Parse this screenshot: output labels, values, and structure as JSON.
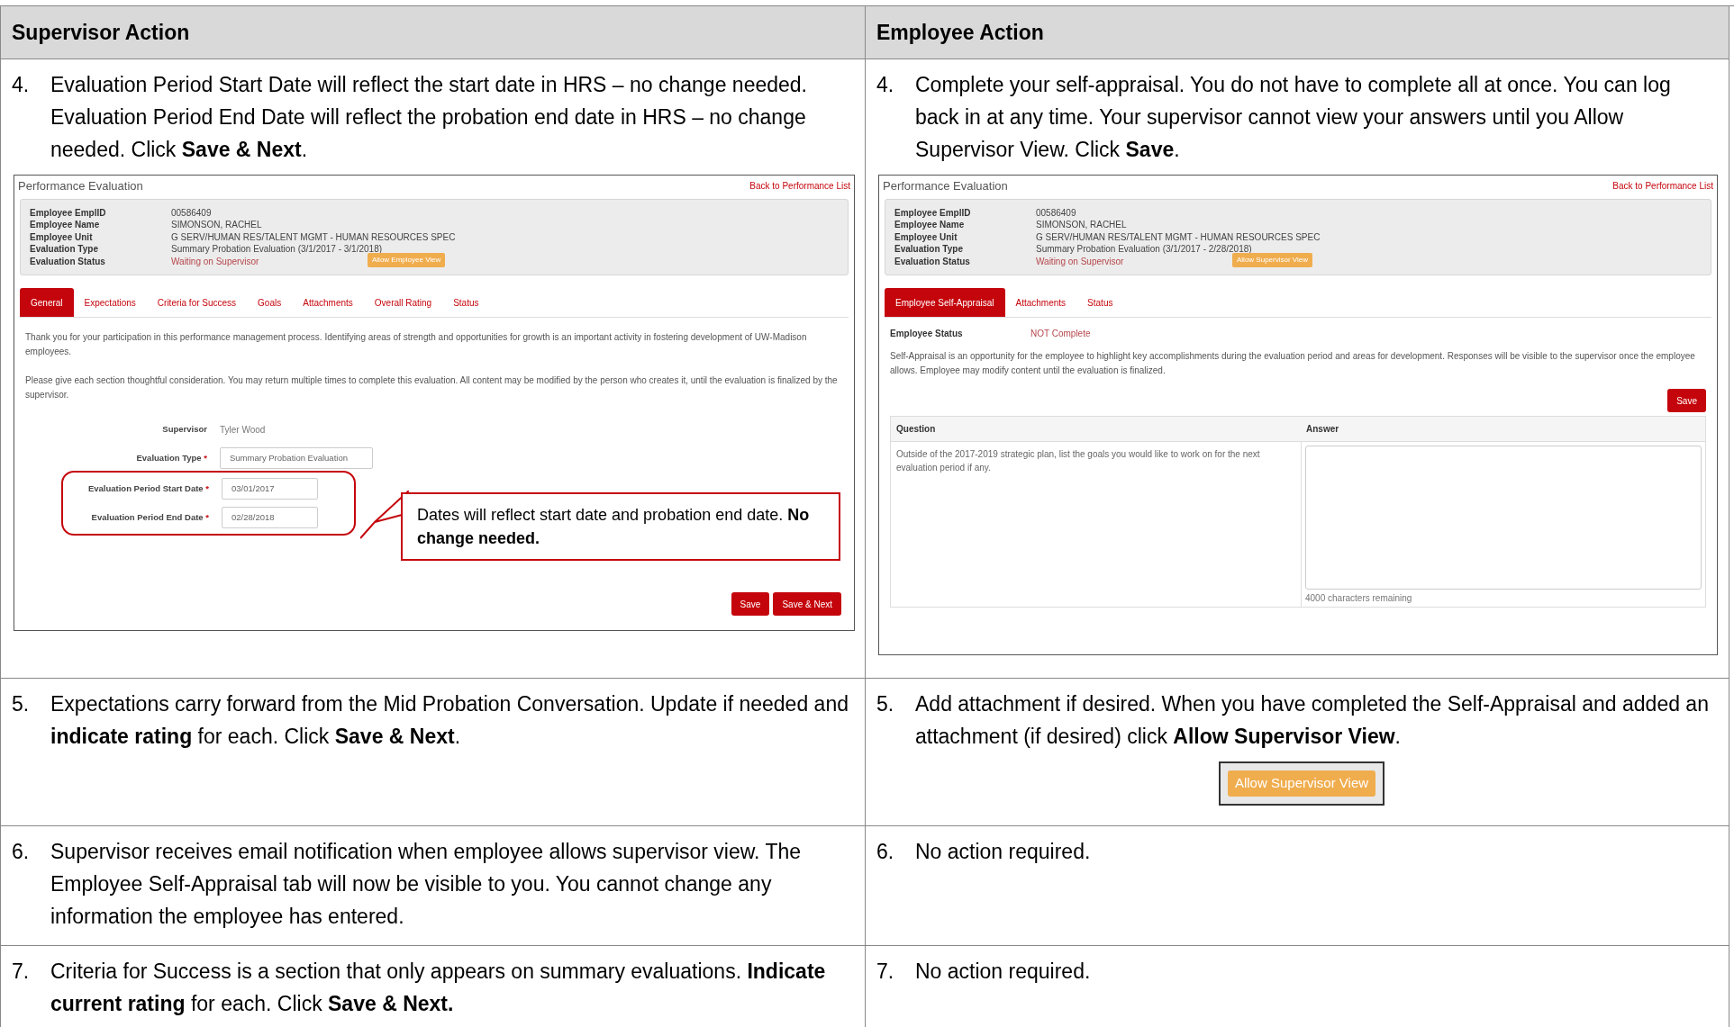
{
  "table": {
    "columns": [
      "Supervisor Action",
      "Employee Action"
    ],
    "rows": [
      {
        "cells": [
          {
            "number": "4.",
            "text": "Evaluation Period Start Date will reflect the start date in HRS – no change needed. Evaluation Period End Date will reflect the probation end date in HRS – no change needed. Click **Save & Next**.",
            "screenshot": {
              "kind": "supervisor",
              "title": "Performance Evaluation",
              "back_link": "Back to Performance List",
              "info": [
                {
                  "label": "Employee EmplID",
                  "value": "00586409",
                  "alert": false
                },
                {
                  "label": "Employee Name",
                  "value": "SIMONSON, RACHEL",
                  "alert": false
                },
                {
                  "label": "Employee Unit",
                  "value": "G SERV/HUMAN RES/TALENT MGMT - HUMAN RESOURCES SPEC",
                  "alert": false
                },
                {
                  "label": "Evaluation Type",
                  "value": "Summary Probation Evaluation (3/1/2017 - 3/1/2018)",
                  "alert": false
                },
                {
                  "label": "Evaluation Status",
                  "value": "Waiting on Supervisor",
                  "alert": true
                }
              ],
              "allow_button": "Allow Employee View",
              "tabs": [
                {
                  "label": "General",
                  "selected": true
                },
                {
                  "label": "Expectations",
                  "selected": false
                },
                {
                  "label": "Criteria for Success",
                  "selected": false
                },
                {
                  "label": "Goals",
                  "selected": false
                },
                {
                  "label": "Attachments",
                  "selected": false
                },
                {
                  "label": "Overall Rating",
                  "selected": false
                },
                {
                  "label": "Status",
                  "selected": false
                }
              ],
              "paragraphs": [
                "Thank you for your participation in this performance management process. Identifying areas of strength and opportunities for growth is an important activity in fostering development of UW-Madison employees.",
                "Please give each section thoughtful consideration. You may return multiple times to complete this evaluation. All content may be modified by the person who creates it, until the evaluation is finalized by the supervisor."
              ],
              "fields": [
                {
                  "label": "Supervisor",
                  "value": "Tyler Wood",
                  "kind": "text"
                },
                {
                  "label": "Evaluation Type",
                  "mark": "*",
                  "value": "Summary Probation Evaluation",
                  "kind": "input"
                }
              ],
              "highlighted_fields": [
                {
                  "label": "Evaluation Period Start Date",
                  "mark": "*",
                  "value": "03/01/2017",
                  "kind": "input"
                },
                {
                  "label": "Evaluation Period End Date",
                  "mark": "*",
                  "value": "02/28/2018",
                  "kind": "input"
                }
              ],
              "callout": "Dates will reflect start date and probation end date. **No change needed.**",
              "buttons": [
                "Save",
                "Save & Next"
              ]
            }
          },
          {
            "number": "4.",
            "text": "Complete your self-appraisal. You do not have to complete all at once. You can log back in at any time. Your supervisor cannot view your answers until you Allow Supervisor View. Click **Save**.",
            "screenshot": {
              "kind": "employee",
              "title": "Performance Evaluation",
              "back_link": "Back to Performance List",
              "info": [
                {
                  "label": "Employee EmplID",
                  "value": "00586409",
                  "alert": false
                },
                {
                  "label": "Employee Name",
                  "value": "SIMONSON, RACHEL",
                  "alert": false
                },
                {
                  "label": "Employee Unit",
                  "value": "G SERV/HUMAN RES/TALENT MGMT - HUMAN RESOURCES SPEC",
                  "alert": false
                },
                {
                  "label": "Evaluation Type",
                  "value": "Summary Probation Evaluation (3/1/2017 - 2/28/2018)",
                  "alert": false
                },
                {
                  "label": "Evaluation Status",
                  "value": "Waiting on Supervisor",
                  "alert": true
                }
              ],
              "allow_button": "Allow Supervisor View",
              "tabs": [
                {
                  "label": "Employee Self-Appraisal",
                  "selected": true
                },
                {
                  "label": "Attachments",
                  "selected": false
                },
                {
                  "label": "Status",
                  "selected": false
                }
              ],
              "status": {
                "label": "Employee Status",
                "value": "NOT Complete"
              },
              "paragraphs": [
                "Self-Appraisal is an opportunity for the employee to highlight key accomplishments during the evaluation period and areas for development. Responses will be visible to the supervisor once the employee allows. Employee may modify content until the evaluation is finalized."
              ],
              "buttons": [
                "Save"
              ],
              "qa": {
                "columns": [
                  "Question",
                  "Answer"
                ],
                "question": "Outside of the 2017-2019 strategic plan, list the goals you would like to work on for the next evaluation period if any.",
                "counter": "4000 characters remaining"
              }
            }
          }
        ]
      },
      {
        "cells": [
          {
            "number": "5.",
            "text": "Expectations carry forward from the Mid Probation Conversation. Update if needed and **indicate rating** for each. Click **Save & Next**."
          },
          {
            "number": "5.",
            "text": "Add attachment if desired. When you have completed the Self-Appraisal and added an attachment (if desired) click **Allow Supervisor View**.",
            "button": "Allow Supervisor View"
          }
        ]
      },
      {
        "cells": [
          {
            "number": "6.",
            "text": "Supervisor receives email notification when employee allows supervisor view. The Employee Self-Appraisal tab will now be visible to you. You cannot change any information the employee has entered."
          },
          {
            "number": "6.",
            "text": "No action required."
          }
        ]
      },
      {
        "cells": [
          {
            "number": "7.",
            "text": "Criteria for Success is a section that only appears on summary evaluations. **Indicate current rating** for each. Click **Save & Next.**"
          },
          {
            "number": "7.",
            "text": "No action required."
          }
        ]
      }
    ]
  }
}
